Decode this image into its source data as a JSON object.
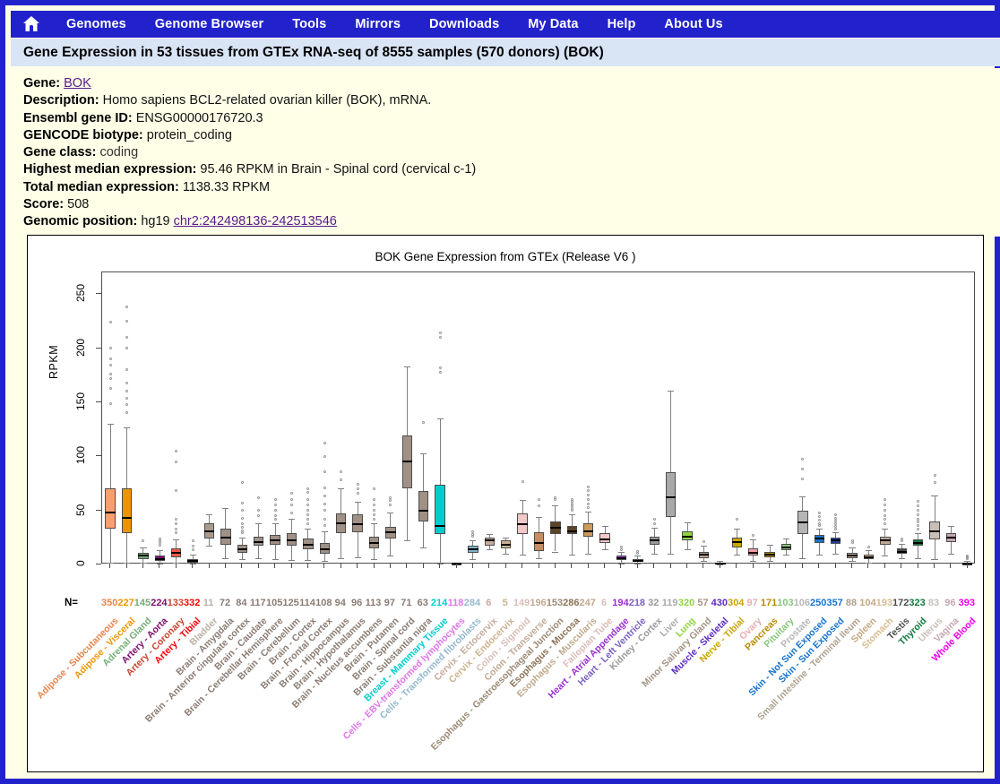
{
  "nav": {
    "home_icon": "home-icon",
    "items": [
      "Genomes",
      "Genome Browser",
      "Tools",
      "Mirrors",
      "Downloads",
      "My Data",
      "Help",
      "About Us"
    ]
  },
  "header": {
    "title": "Gene Expression in 53 tissues from GTEx RNA-seq of 8555 samples (570 donors) (BOK)"
  },
  "info": {
    "gene_label": "Gene:",
    "gene_value": "BOK",
    "description_label": "Description:",
    "description_value": "Homo sapiens BCL2-related ovarian killer (BOK), mRNA.",
    "ensembl_label": "Ensembl gene ID:",
    "ensembl_value": "ENSG00000176720.3",
    "biotype_label": "GENCODE biotype:",
    "biotype_value": "protein_coding",
    "geneclass_label": "Gene class:",
    "geneclass_value": "coding",
    "highest_label": "Highest median expression:",
    "highest_value": "95.46 RPKM in Brain - Spinal cord (cervical c-1)",
    "total_label": "Total median expression:",
    "total_value": "1138.33 RPKM",
    "score_label": "Score:",
    "score_value": "508",
    "position_label": "Genomic position:",
    "position_assembly": "hg19",
    "position_value": "chr2:242498136-242513546"
  },
  "chart_data": {
    "type": "boxplot",
    "title": "BOK Gene Expression from GTEx (Release  V6 )",
    "xlabel": "",
    "ylabel": "RPKM",
    "ylim": [
      0,
      270
    ],
    "yticks": [
      0,
      50,
      100,
      150,
      200,
      250
    ],
    "n_row_label": "N=",
    "grid": false,
    "categories": [
      "Adipose - Subcutaneous",
      "Adipose - Visceral",
      "Adrenal Gland",
      "Artery - Aorta",
      "Artery - Coronary",
      "Artery - Tibial",
      "Bladder",
      "Brain - Amygdala",
      "Brain - Anterior cingulate cortex",
      "Brain - Caudate",
      "Brain - Cerebellar Hemisphere",
      "Brain - Cerebellum",
      "Brain - Cortex",
      "Brain - Frontal Cortex",
      "Brain - Hippocampus",
      "Brain - Hypothalamus",
      "Brain - Nucleus accumbens",
      "Brain - Putamen",
      "Brain - Spinal cord",
      "Brain - Substantia nigra",
      "Breast - Mammary Tissue",
      "Cells - EBV-transformed lymphocytes",
      "Cells - Transformed fibroblasts",
      "Cervix - Ectocervix",
      "Cervix - Endocervix",
      "Colon - Sigmoid",
      "Colon - Transverse",
      "Esophagus - Gastroesophageal Junction",
      "Esophagus - Mucosa",
      "Esophagus - Muscularis",
      "Fallopian Tube",
      "Heart - Atrial Appendage",
      "Heart - Left Ventricle",
      "Kidney - Cortex",
      "Liver",
      "Lung",
      "Minor Salivary Gland",
      "Muscle - Skeletal",
      "Nerve - Tibial",
      "Ovary",
      "Pancreas",
      "Pituitary",
      "Prostate",
      "Skin - Not Sun Exposed",
      "Skin - Sun Exposed",
      "Small Intestine - Terminal Ileum",
      "Spleen",
      "Stomach",
      "Testis",
      "Thyroid",
      "Uterus",
      "Vagina",
      "Whole Blood"
    ],
    "sample_counts": [
      350,
      227,
      145,
      224,
      133,
      332,
      11,
      72,
      84,
      117,
      105,
      125,
      114,
      108,
      94,
      96,
      113,
      97,
      71,
      63,
      214,
      118,
      284,
      6,
      5,
      149,
      196,
      153,
      286,
      247,
      6,
      194,
      218,
      32,
      119,
      320,
      57,
      430,
      304,
      97,
      171,
      103,
      106,
      250,
      357,
      88,
      104,
      193,
      172,
      323,
      83,
      96,
      393
    ],
    "colors": [
      "#FF9E6B",
      "#EE9400",
      "#74AD74",
      "#7C0E6B",
      "#F05A4A",
      "#D40000",
      "#AB9A8C",
      "#A09086",
      "#A09086",
      "#A09086",
      "#A09086",
      "#A09086",
      "#A09086",
      "#A09086",
      "#A09086",
      "#A09086",
      "#A09086",
      "#A09086",
      "#A09086",
      "#A09086",
      "#00CDCD",
      "#DE75E8",
      "#7EB3CC",
      "#C7AB9C",
      "#CCB28E",
      "#F3C8C8",
      "#C88C63",
      "#5B4427",
      "#5B4427",
      "#CC9A5B",
      "#F3C8C8",
      "#9A2FD4",
      "#5C2AA8",
      "#9A9A9A",
      "#A9A9A9",
      "#8FD43E",
      "#B9A58B",
      "#5C2AC0",
      "#CCA300",
      "#F29FAB",
      "#B88A00",
      "#86C67A",
      "#B5B5B5",
      "#1874CD",
      "#1C3FA8",
      "#BDAA96",
      "#CCAD7A",
      "#BDAA96",
      "#4C4C4C",
      "#117A3D",
      "#C9BEB6",
      "#C4A6B2",
      "#EE00EE"
    ],
    "label_colors": [
      "#E8834B",
      "#EE9400",
      "#74AD74",
      "#7C0E6B",
      "#C8452F",
      "#FF0000",
      "#BBAFA3",
      "#8A7C74",
      "#8A7C74",
      "#8A7C74",
      "#8A7C74",
      "#8A7C74",
      "#8A7C74",
      "#8A7C74",
      "#8A7C74",
      "#8A7C74",
      "#8A7C74",
      "#8A7C74",
      "#8A7C74",
      "#8A7C74",
      "#00CDCD",
      "#DE75E8",
      "#93B9CE",
      "#C7AB9C",
      "#CCB28E",
      "#D9BDB8",
      "#C0AA93",
      "#9C8A76",
      "#8B7355",
      "#BFA98C",
      "#D9BDB8",
      "#9A2FD4",
      "#7A62C0",
      "#9A9A9A",
      "#AAAAAA",
      "#8FD43E",
      "#A39384",
      "#5C2AC0",
      "#CCA300",
      "#E8AEB5",
      "#B88A00",
      "#86C67A",
      "#B5B5B5",
      "#1874CD",
      "#1874CD",
      "#AFA08E",
      "#C3A882",
      "#D9BC8F",
      "#4C4C4C",
      "#117A3D",
      "#C9BEB6",
      "#C4A6B2",
      "#EE00EE"
    ],
    "boxes": [
      {
        "low": 2,
        "q1": 33,
        "med": 48,
        "q3": 70,
        "high": 130,
        "out": [
          149,
          163,
          172,
          176,
          184,
          190,
          200,
          224
        ]
      },
      {
        "low": 2,
        "q1": 29,
        "med": 43,
        "q3": 70,
        "high": 127,
        "out": [
          140,
          148,
          154,
          160,
          168,
          180,
          200,
          210,
          225,
          238
        ]
      },
      {
        "low": 2,
        "q1": 5,
        "med": 8,
        "q3": 11,
        "high": 16,
        "out": [
          22
        ]
      },
      {
        "low": 1,
        "q1": 3,
        "med": 5,
        "q3": 8,
        "high": 13,
        "out": [
          18,
          20,
          22,
          24
        ]
      },
      {
        "low": 2,
        "q1": 7,
        "med": 11,
        "q3": 15,
        "high": 23,
        "out": [
          29,
          33,
          38,
          42,
          68,
          95,
          105
        ]
      },
      {
        "low": 1,
        "q1": 2,
        "med": 3,
        "q3": 5,
        "high": 9,
        "out": [
          14,
          17,
          22
        ]
      },
      {
        "low": 17,
        "q1": 24,
        "med": 31,
        "q3": 38,
        "high": 46,
        "out": []
      },
      {
        "low": 6,
        "q1": 18,
        "med": 25,
        "q3": 33,
        "high": 52,
        "out": []
      },
      {
        "low": 5,
        "q1": 11,
        "med": 14,
        "q3": 18,
        "high": 25,
        "out": [
          29,
          31,
          34,
          38,
          43,
          50,
          57,
          76
        ]
      },
      {
        "low": 6,
        "q1": 17,
        "med": 21,
        "q3": 26,
        "high": 38,
        "out": [
          45,
          50,
          62
        ]
      },
      {
        "low": 5,
        "q1": 18,
        "med": 22,
        "q3": 27,
        "high": 38,
        "out": [
          42,
          45,
          50,
          55,
          60
        ]
      },
      {
        "low": 4,
        "q1": 17,
        "med": 22,
        "q3": 29,
        "high": 42,
        "out": [
          48,
          55,
          60,
          66
        ]
      },
      {
        "low": 4,
        "q1": 14,
        "med": 18,
        "q3": 24,
        "high": 33,
        "out": [
          38,
          42,
          46,
          50,
          55,
          60,
          67,
          70
        ]
      },
      {
        "low": 3,
        "q1": 10,
        "med": 14,
        "q3": 20,
        "high": 31,
        "out": [
          36,
          42,
          50,
          56,
          63,
          71,
          86,
          100,
          112
        ]
      },
      {
        "low": 6,
        "q1": 29,
        "med": 38,
        "q3": 47,
        "high": 70,
        "out": [
          78,
          86
        ]
      },
      {
        "low": 7,
        "q1": 30,
        "med": 37,
        "q3": 46,
        "high": 58,
        "out": [
          66,
          70,
          74
        ]
      },
      {
        "low": 5,
        "q1": 15,
        "med": 20,
        "q3": 26,
        "high": 38,
        "out": [
          42,
          46,
          50,
          55,
          60,
          70
        ]
      },
      {
        "low": 8,
        "q1": 24,
        "med": 30,
        "q3": 35,
        "high": 48,
        "out": [
          55,
          59,
          62
        ]
      },
      {
        "low": 22,
        "q1": 70,
        "med": 95,
        "q3": 119,
        "high": 183,
        "out": []
      },
      {
        "low": 16,
        "q1": 40,
        "med": 50,
        "q3": 68,
        "high": 103,
        "out": [
          131
        ]
      },
      {
        "low": 1,
        "q1": 28,
        "med": 36,
        "q3": 74,
        "high": 135,
        "out": [
          178,
          182,
          210,
          214
        ]
      },
      {
        "low": 0,
        "q1": 0.5,
        "med": 0.8,
        "q3": 1.2,
        "high": 2,
        "out": []
      },
      {
        "low": 5,
        "q1": 11,
        "med": 14,
        "q3": 17,
        "high": 22,
        "out": [
          26,
          28,
          30
        ]
      },
      {
        "low": 14,
        "q1": 17,
        "med": 22,
        "q3": 25,
        "high": 28,
        "out": []
      },
      {
        "low": 10,
        "q1": 15,
        "med": 18,
        "q3": 22,
        "high": 25,
        "out": []
      },
      {
        "low": 9,
        "q1": 28,
        "med": 37,
        "q3": 47,
        "high": 60,
        "out": [
          77
        ]
      },
      {
        "low": 6,
        "q1": 12,
        "med": 20,
        "q3": 30,
        "high": 44,
        "out": [
          54,
          60
        ]
      },
      {
        "low": 12,
        "q1": 28,
        "med": 34,
        "q3": 40,
        "high": 55,
        "out": [
          60,
          62
        ]
      },
      {
        "low": 9,
        "q1": 28,
        "med": 31,
        "q3": 36,
        "high": 46,
        "out": [
          50,
          52,
          54,
          56,
          58,
          60
        ]
      },
      {
        "low": 10,
        "q1": 26,
        "med": 31,
        "q3": 38,
        "high": 49,
        "out": [
          53,
          56,
          60,
          64,
          68,
          72
        ]
      },
      {
        "low": 14,
        "q1": 20,
        "med": 23,
        "q3": 29,
        "high": 36,
        "out": []
      },
      {
        "low": 1,
        "q1": 4,
        "med": 6,
        "q3": 8,
        "high": 12,
        "out": [
          14,
          16
        ]
      },
      {
        "low": 1,
        "q1": 2.5,
        "med": 3.5,
        "q3": 5,
        "high": 8,
        "out": [
          10,
          12
        ]
      },
      {
        "low": 10,
        "q1": 18,
        "med": 22,
        "q3": 26,
        "high": 34,
        "out": [
          38,
          42
        ]
      },
      {
        "low": 10,
        "q1": 44,
        "med": 62,
        "q3": 85,
        "high": 161,
        "out": []
      },
      {
        "low": 14,
        "q1": 22,
        "med": 26,
        "q3": 31,
        "high": 39,
        "out": []
      },
      {
        "low": 3,
        "q1": 6,
        "med": 9,
        "q3": 12,
        "high": 17,
        "out": [
          21
        ]
      },
      {
        "low": 0.3,
        "q1": 0.8,
        "med": 1.2,
        "q3": 1.8,
        "high": 3,
        "out": []
      },
      {
        "low": 9,
        "q1": 16,
        "med": 21,
        "q3": 25,
        "high": 33,
        "out": [
          42
        ]
      },
      {
        "low": 3,
        "q1": 8,
        "med": 11,
        "q3": 15,
        "high": 23,
        "out": [
          27
        ]
      },
      {
        "low": 3,
        "q1": 7,
        "med": 9,
        "q3": 12,
        "high": 18,
        "out": []
      },
      {
        "low": 9,
        "q1": 13,
        "med": 16,
        "q3": 19,
        "high": 24,
        "out": []
      },
      {
        "low": 6,
        "q1": 28,
        "med": 39,
        "q3": 50,
        "high": 63,
        "out": [
          79,
          88,
          97
        ]
      },
      {
        "low": 9,
        "q1": 20,
        "med": 24,
        "q3": 27,
        "high": 33,
        "out": [
          36,
          38,
          41,
          44,
          48
        ]
      },
      {
        "low": 10,
        "q1": 19,
        "med": 22,
        "q3": 25,
        "high": 30,
        "out": [
          33,
          35,
          38,
          40,
          43,
          46
        ]
      },
      {
        "low": 3,
        "q1": 6,
        "med": 8,
        "q3": 11,
        "high": 16,
        "out": [
          20,
          22
        ]
      },
      {
        "low": 2,
        "q1": 5,
        "med": 7,
        "q3": 9,
        "high": 13,
        "out": [
          16
        ]
      },
      {
        "low": 8,
        "q1": 18,
        "med": 22,
        "q3": 26,
        "high": 33,
        "out": [
          38,
          42,
          45,
          50,
          55,
          60
        ]
      },
      {
        "low": 6,
        "q1": 10,
        "med": 12,
        "q3": 15,
        "high": 19,
        "out": [
          22,
          24
        ]
      },
      {
        "low": 6,
        "q1": 17,
        "med": 20,
        "q3": 23,
        "high": 29,
        "out": [
          33,
          36,
          39,
          42,
          46,
          50,
          54,
          58
        ]
      },
      {
        "low": 5,
        "q1": 23,
        "med": 31,
        "q3": 40,
        "high": 64,
        "out": [
          76,
          82
        ]
      },
      {
        "low": 10,
        "q1": 21,
        "med": 25,
        "q3": 29,
        "high": 36,
        "out": []
      },
      {
        "low": 0,
        "q1": 0.3,
        "med": 0.6,
        "q3": 1,
        "high": 3,
        "out": [
          5,
          6,
          7,
          8
        ]
      }
    ]
  }
}
